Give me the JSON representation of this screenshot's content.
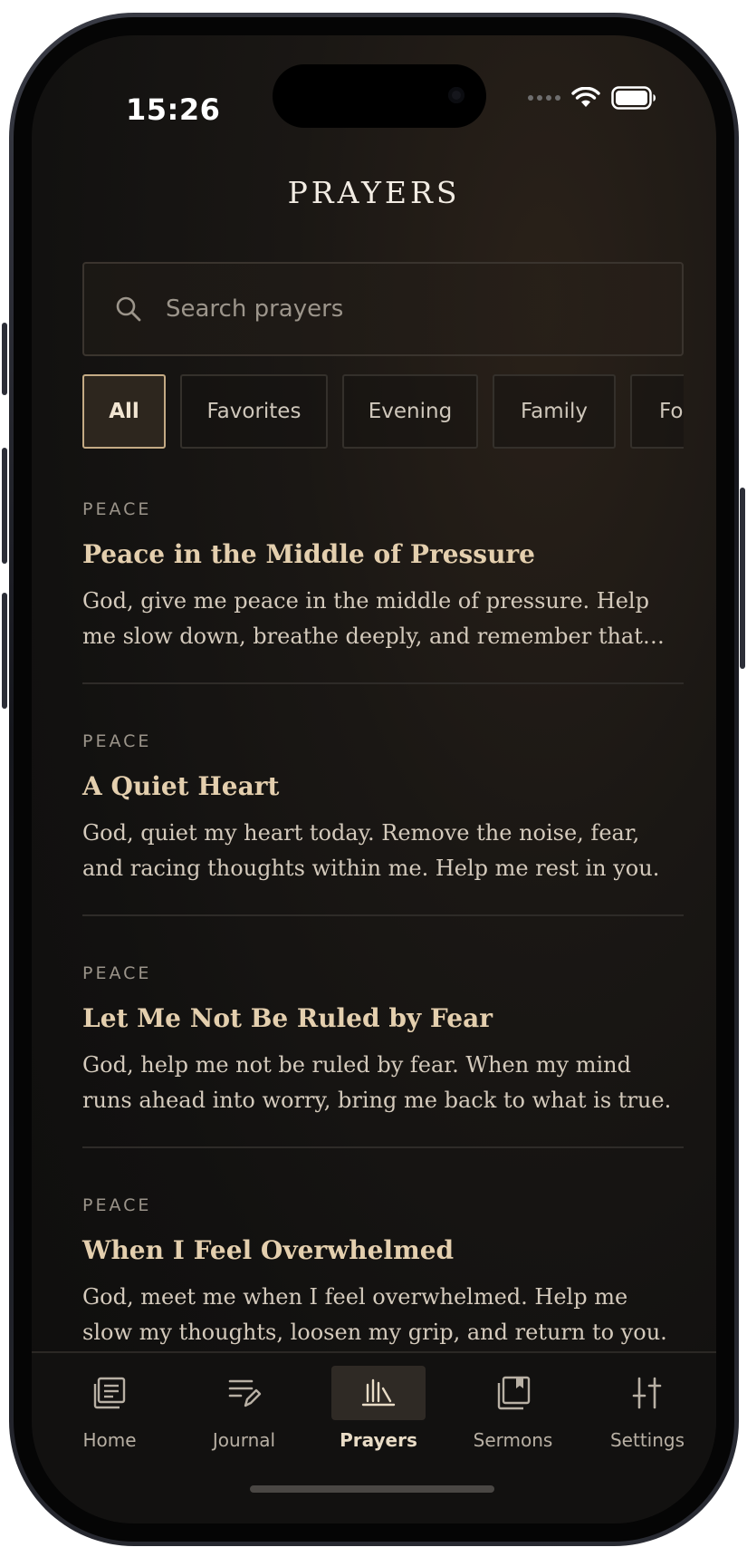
{
  "status_bar": {
    "time": "15:26"
  },
  "header": {
    "title": "PRAYERS"
  },
  "search": {
    "placeholder": "Search prayers",
    "value": ""
  },
  "filters": [
    {
      "label": "All",
      "active": true
    },
    {
      "label": "Favorites",
      "active": false
    },
    {
      "label": "Evening",
      "active": false
    },
    {
      "label": "Family",
      "active": false
    },
    {
      "label": "Forgiveness",
      "active": false
    }
  ],
  "prayers": [
    {
      "category": "PEACE",
      "title": "Peace in the Middle of Pressure",
      "excerpt": "God, give me peace in the middle of pressure. Help me slow down, breathe deeply, and remember that you are with me."
    },
    {
      "category": "PEACE",
      "title": "A Quiet Heart",
      "excerpt": "God, quiet my heart today. Remove the noise, fear, and racing thoughts within me. Help me rest in you."
    },
    {
      "category": "PEACE",
      "title": "Let Me Not Be Ruled by Fear",
      "excerpt": "God, help me not be ruled by fear. When my mind runs ahead into worry, bring me back to what is true."
    },
    {
      "category": "PEACE",
      "title": "When I Feel Overwhelmed",
      "excerpt": "God, meet me when I feel overwhelmed. Help me slow my thoughts, loosen my grip, and return to you."
    }
  ],
  "tabbar": [
    {
      "label": "Home",
      "icon": "home-icon",
      "active": false
    },
    {
      "label": "Journal",
      "icon": "journal-icon",
      "active": false
    },
    {
      "label": "Prayers",
      "icon": "prayers-icon",
      "active": true
    },
    {
      "label": "Sermons",
      "icon": "sermons-icon",
      "active": false
    },
    {
      "label": "Settings",
      "icon": "settings-icon",
      "active": false
    }
  ],
  "colors": {
    "accent": "#e4cfae",
    "background": "#121110",
    "chip_active_border": "#c4aa84"
  }
}
